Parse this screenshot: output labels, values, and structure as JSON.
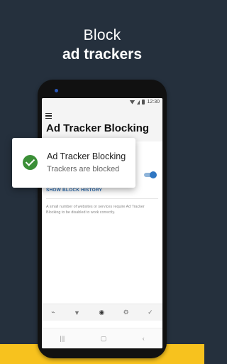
{
  "headline": {
    "line1": "Block",
    "line2": "ad trackers"
  },
  "status_bar": {
    "time": "12:30"
  },
  "app": {
    "title": "Ad Tracker Blocking",
    "show_history": "SHOW BLOCK HISTORY",
    "note": "A small number of websites or services require Ad Tracker Blocking to be disabled to work correctly.",
    "toggle_on": true
  },
  "bottom_nav": [
    {
      "icon": "wifi-lock-icon",
      "glyph": "⌁"
    },
    {
      "icon": "location-pin-icon",
      "glyph": "▼"
    },
    {
      "icon": "eye-slash-icon",
      "glyph": "◉",
      "active": true
    },
    {
      "icon": "wifi-gear-icon",
      "glyph": "⚙"
    },
    {
      "icon": "shield-check-icon",
      "glyph": "✓"
    }
  ],
  "system_nav": [
    {
      "icon": "recent-apps-icon",
      "glyph": "|||"
    },
    {
      "icon": "home-icon",
      "glyph": "▢"
    },
    {
      "icon": "back-icon",
      "glyph": "‹"
    }
  ],
  "toast": {
    "title": "Ad Tracker Blocking",
    "subtitle": "Trackers are blocked"
  },
  "colors": {
    "background": "#25303d",
    "accent_yellow": "#f7c21e",
    "success_green": "#3b8f37",
    "link_blue": "#2f6fb3"
  }
}
